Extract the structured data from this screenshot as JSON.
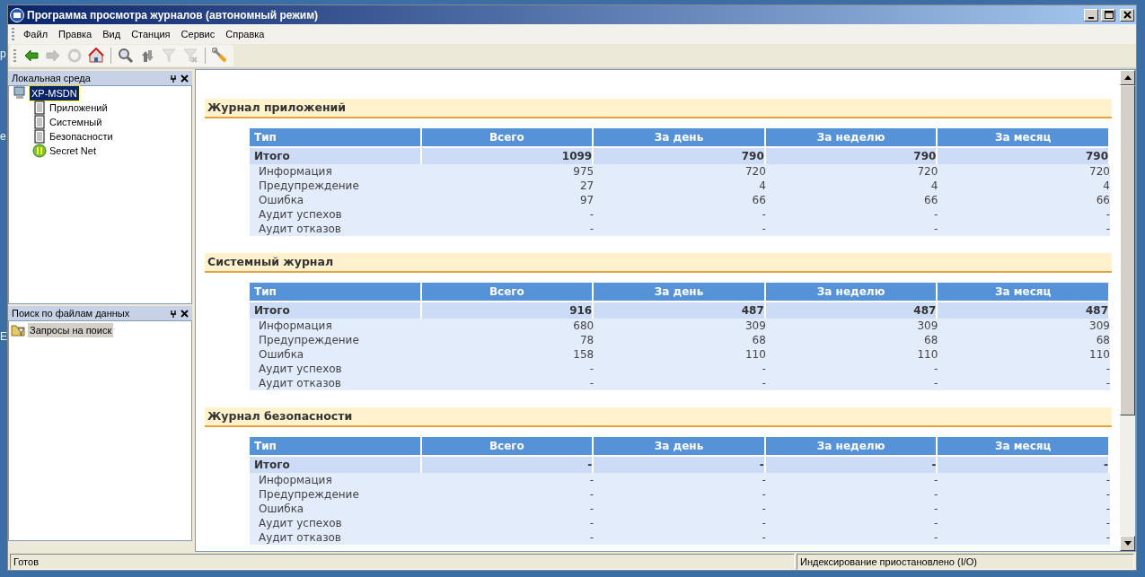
{
  "desktop": {
    "fragments": [
      "р",
      "е",
      "Е"
    ]
  },
  "window": {
    "title": "Программа просмотра журналов (автономный режим)"
  },
  "menu": [
    {
      "label": "Файл"
    },
    {
      "label": "Правка"
    },
    {
      "label": "Вид"
    },
    {
      "label": "Станция"
    },
    {
      "label": "Сервис"
    },
    {
      "label": "Справка"
    }
  ],
  "toolbar": [
    {
      "kind": "back",
      "disabled": false
    },
    {
      "kind": "forward",
      "disabled": true
    },
    {
      "kind": "refresh",
      "disabled": true
    },
    {
      "kind": "home",
      "disabled": false
    },
    {
      "kind": "sep"
    },
    {
      "kind": "search",
      "disabled": false
    },
    {
      "kind": "sort",
      "disabled": false
    },
    {
      "kind": "filter",
      "disabled": true
    },
    {
      "kind": "filter-clear",
      "disabled": true
    },
    {
      "kind": "sep"
    },
    {
      "kind": "tools",
      "disabled": false
    }
  ],
  "local_panel": {
    "title": "Локальная среда",
    "tree": [
      {
        "label": "XP-MSDN",
        "kind": "computer",
        "selected": true,
        "children": [
          {
            "label": "Приложений",
            "kind": "log",
            "selected": false
          },
          {
            "label": "Системный",
            "kind": "log",
            "selected": false
          },
          {
            "label": "Безопасности",
            "kind": "log",
            "selected": false
          },
          {
            "label": "Secret Net",
            "kind": "secretnet",
            "selected": false
          }
        ]
      }
    ]
  },
  "search_panel": {
    "title": "Поиск по файлам данных",
    "items": [
      {
        "label": "Запросы на поиск",
        "selected": true
      }
    ]
  },
  "sections": [
    {
      "title": "Журнал приложений",
      "columns": [
        "Тип",
        "Всего",
        "За день",
        "За неделю",
        "За месяц"
      ],
      "total": [
        "Итого",
        "1099",
        "790",
        "790",
        "790"
      ],
      "rows": [
        [
          "Информация",
          "975",
          "720",
          "720",
          "720"
        ],
        [
          "Предупреждение",
          "27",
          "4",
          "4",
          "4"
        ],
        [
          "Ошибка",
          "97",
          "66",
          "66",
          "66"
        ],
        [
          "Аудит успехов",
          "-",
          "-",
          "-",
          "-"
        ],
        [
          "Аудит отказов",
          "-",
          "-",
          "-",
          "-"
        ]
      ]
    },
    {
      "title": "Системный журнал",
      "columns": [
        "Тип",
        "Всего",
        "За день",
        "За неделю",
        "За месяц"
      ],
      "total": [
        "Итого",
        "916",
        "487",
        "487",
        "487"
      ],
      "rows": [
        [
          "Информация",
          "680",
          "309",
          "309",
          "309"
        ],
        [
          "Предупреждение",
          "78",
          "68",
          "68",
          "68"
        ],
        [
          "Ошибка",
          "158",
          "110",
          "110",
          "110"
        ],
        [
          "Аудит успехов",
          "-",
          "-",
          "-",
          "-"
        ],
        [
          "Аудит отказов",
          "-",
          "-",
          "-",
          "-"
        ]
      ]
    },
    {
      "title": "Журнал безопасности",
      "columns": [
        "Тип",
        "Всего",
        "За день",
        "За неделю",
        "За месяц"
      ],
      "total": [
        "Итого",
        "-",
        "-",
        "-",
        "-"
      ],
      "rows": [
        [
          "Информация",
          "-",
          "-",
          "-",
          "-"
        ],
        [
          "Предупреждение",
          "-",
          "-",
          "-",
          "-"
        ],
        [
          "Ошибка",
          "-",
          "-",
          "-",
          "-"
        ],
        [
          "Аудит успехов",
          "-",
          "-",
          "-",
          "-"
        ],
        [
          "Аудит отказов",
          "-",
          "-",
          "-",
          "-"
        ]
      ]
    }
  ],
  "status_bar": [
    "Готов",
    "Индексирование приостановлено (I/O)"
  ]
}
